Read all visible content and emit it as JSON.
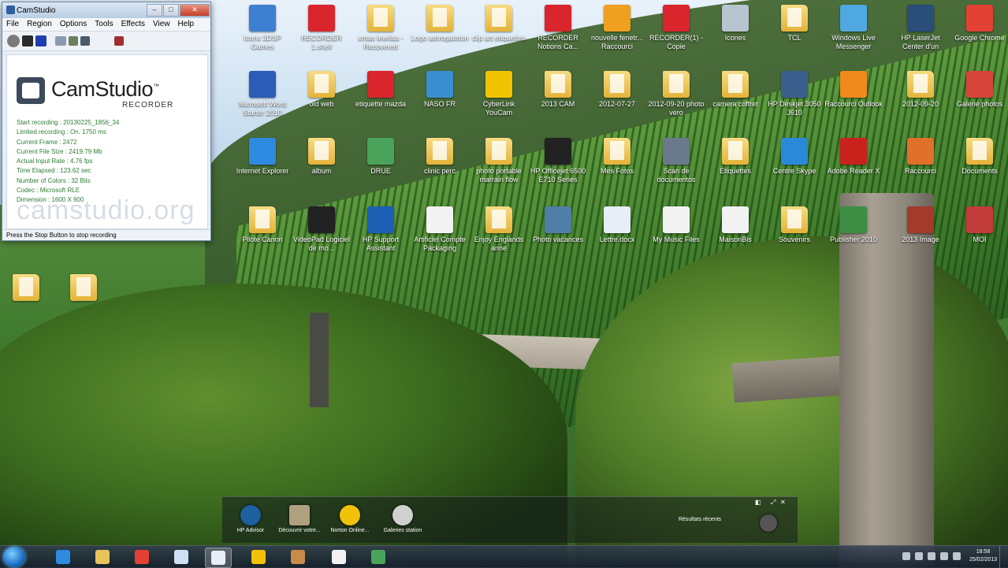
{
  "camstudio": {
    "title": "CamStudio",
    "menu": [
      "File",
      "Region",
      "Options",
      "Tools",
      "Effects",
      "View",
      "Help"
    ],
    "logo": "CamStudio",
    "logo_tm": "™",
    "logo_sub": "RECORDER",
    "stats": [
      "Start recording : 20130225_1856_34",
      "Limited recording : On, 1750 ms",
      "Current Frame : 2472",
      "Current File Size : 2419.79 Mb",
      "Actual Input Rate : 4.76 fps",
      "Time Elapsed : 123.62 sec",
      "Number of Colors : 32 Bits",
      "Codec : Microsoft RLE",
      "Dimension : 1600 X 900"
    ],
    "watermark": "camstudio.org",
    "status": "Press the Stop Button to stop recording"
  },
  "desktop_icons": [
    {
      "label": "Icons 3DSP Games",
      "type": "app",
      "color": "#3f7fd1"
    },
    {
      "label": "RECORDER 1.shell",
      "type": "app",
      "color": "#d9252b"
    },
    {
      "label": "xmas lewitaa - Recovered",
      "type": "folder",
      "color": "#e8c25a"
    },
    {
      "label": "Logo aetrogateton",
      "type": "folder",
      "color": "#e8c25a"
    },
    {
      "label": "clip art etiquettes",
      "type": "folder",
      "color": "#e8c25a"
    },
    {
      "label": "RECORDER Notions Ca...",
      "type": "app",
      "color": "#d9252b"
    },
    {
      "label": "nouvelle fenetr... Raccourci",
      "type": "app",
      "color": "#f0a020"
    },
    {
      "label": "RECORDER(1) - Copie",
      "type": "app",
      "color": "#d9252b"
    },
    {
      "label": "Icones",
      "type": "app",
      "color": "#b8c4d0"
    },
    {
      "label": "TCL",
      "type": "folder",
      "color": "#e8c25a"
    },
    {
      "label": "Windows Live Messenger",
      "type": "app",
      "color": "#4fa8e0"
    },
    {
      "label": "HP LaserJet Center d'un Officejet",
      "type": "app",
      "color": "#2a4d7a"
    },
    {
      "label": "Google Chrome",
      "type": "app",
      "color": "#e34133"
    },
    {
      "label": "Microsoft Word Starter 2010",
      "type": "app",
      "color": "#2b5cb8"
    },
    {
      "label": "old web",
      "type": "folder",
      "color": "#e8c25a"
    },
    {
      "label": "etiquette mazda",
      "type": "app",
      "color": "#d9252b"
    },
    {
      "label": "NASO FR",
      "type": "app",
      "color": "#3b8fd0"
    },
    {
      "label": "CyberLink YouCam",
      "type": "app",
      "color": "#f2c400"
    },
    {
      "label": "2013 CAM",
      "type": "folder",
      "color": "#e8c25a"
    },
    {
      "label": "2012-07-27",
      "type": "folder",
      "color": "#e8c25a"
    },
    {
      "label": "2012-09-20 photo vero",
      "type": "folder",
      "color": "#e8c25a"
    },
    {
      "label": "camera coffret",
      "type": "folder",
      "color": "#e8c25a"
    },
    {
      "label": "HP Deskjet 3050 J610",
      "type": "app",
      "color": "#3b5f8c"
    },
    {
      "label": "Raccourci Outlook",
      "type": "app",
      "color": "#f08a1c"
    },
    {
      "label": "2012-09-20",
      "type": "folder",
      "color": "#e8c25a"
    },
    {
      "label": "Galerie photos",
      "type": "app",
      "color": "#d7443b"
    },
    {
      "label": "Internet Explorer",
      "type": "app",
      "color": "#2d8ae0"
    },
    {
      "label": "album",
      "type": "folder",
      "color": "#e8c25a"
    },
    {
      "label": "DRUE",
      "type": "app",
      "color": "#4aa35a"
    },
    {
      "label": "clinic perc",
      "type": "folder",
      "color": "#e8c25a"
    },
    {
      "label": "photo portable marrain flow",
      "type": "folder",
      "color": "#e8c25a"
    },
    {
      "label": "HP Officejet 6500 E710 Series",
      "type": "app",
      "color": "#222222"
    },
    {
      "label": "Mes Fotos",
      "type": "folder",
      "color": "#e8c25a"
    },
    {
      "label": "Scan de documentos",
      "type": "app",
      "color": "#6a7a8a"
    },
    {
      "label": "Etiquettes",
      "type": "folder",
      "color": "#e8c25a"
    },
    {
      "label": "Centre Skype",
      "type": "app",
      "color": "#2a8ad8"
    },
    {
      "label": "Adobe Reader X",
      "type": "app",
      "color": "#c9221c"
    },
    {
      "label": "Raccourci",
      "type": "app",
      "color": "#e0702a"
    },
    {
      "label": "Documents",
      "type": "folder",
      "color": "#e8c25a"
    },
    {
      "label": "Pilote Canon",
      "type": "folder",
      "color": "#e8c25a"
    },
    {
      "label": "VideoPad Logiciel de mo...",
      "type": "app",
      "color": "#222222"
    },
    {
      "label": "HP Support Assistant",
      "type": "app",
      "color": "#1c5fb5"
    },
    {
      "label": "Artificiel Compte Packaging",
      "type": "app",
      "color": "#f2f2f2"
    },
    {
      "label": "Enjoy Englands anne",
      "type": "folder",
      "color": "#e8c25a"
    },
    {
      "label": "Photo vacances",
      "type": "app",
      "color": "#4f7fa8"
    },
    {
      "label": "Lettre.docx",
      "type": "app",
      "color": "#e7eef8"
    },
    {
      "label": "My Music Files",
      "type": "app",
      "color": "#f2f2f2"
    },
    {
      "label": "MaisonBis",
      "type": "app",
      "color": "#f2f2f2"
    },
    {
      "label": "Souvenirs",
      "type": "folder",
      "color": "#e8c25a"
    },
    {
      "label": "Publisher 2010",
      "type": "app",
      "color": "#3e8e45"
    },
    {
      "label": "2013 Image",
      "type": "app",
      "color": "#a33a2b"
    },
    {
      "label": "MOI",
      "type": "app",
      "color": "#c23b3b"
    },
    {
      "label": "",
      "type": "folder",
      "color": "#e8c25a"
    },
    {
      "label": "",
      "type": "folder",
      "color": "#e8c25a"
    }
  ],
  "gadgets": [
    {
      "label": "HP Advisor",
      "color": "#1d5f9f"
    },
    {
      "label": "Découvrir votre...",
      "color": "#b0a080"
    },
    {
      "label": "Norton Online...",
      "color": "#f2c20b"
    },
    {
      "label": "Galeries station",
      "color": "#d0d0d0"
    },
    {
      "label": "Résultats récents",
      "color": "#555555"
    }
  ],
  "taskbar": {
    "apps": [
      {
        "name": "internet-explorer",
        "color": "#2d8ae0",
        "active": false
      },
      {
        "name": "file-explorer",
        "color": "#e8c25a",
        "active": false
      },
      {
        "name": "google-chrome",
        "color": "#e34133",
        "active": false
      },
      {
        "name": "notepad",
        "color": "#cfe0f2",
        "active": false
      },
      {
        "name": "camstudio",
        "color": "#e8eef5",
        "active": true
      },
      {
        "name": "security",
        "color": "#f2c20b",
        "active": false
      },
      {
        "name": "paint",
        "color": "#c98a4a",
        "active": false
      },
      {
        "name": "document",
        "color": "#f2f2f2",
        "active": false
      },
      {
        "name": "map",
        "color": "#4aa35a",
        "active": false
      }
    ],
    "time": "18:58",
    "date": "25/02/2013"
  }
}
